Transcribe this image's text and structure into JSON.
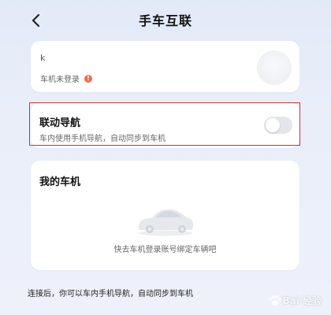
{
  "header": {
    "title": "手车互联"
  },
  "account": {
    "name": "k",
    "status": "车机未登录",
    "warn_glyph": "!"
  },
  "nav_sync": {
    "title": "联动导航",
    "description": "车内使用手机导航，自动同步到车机",
    "toggle_on": false
  },
  "my_car": {
    "title": "我的车机",
    "hint": "快去车机登录账号绑定车辆吧"
  },
  "footer": {
    "note": "连接后，你可以车内手机导航，自动同步到车机"
  },
  "watermark": {
    "text": "Bai 经验"
  },
  "colors": {
    "highlight": "#d3322f",
    "warning": "#f26b4f"
  }
}
